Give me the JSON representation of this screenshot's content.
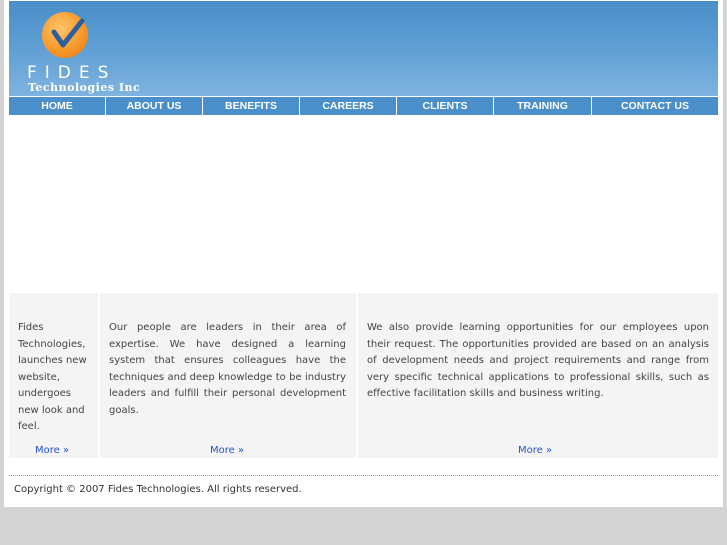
{
  "brand": {
    "name": "FIDES",
    "subtitle": "Technologies Inc"
  },
  "nav": {
    "items": [
      "HOME",
      "ABOUT US",
      "BENEFITS",
      "CAREERS",
      "CLIENTS",
      "TRAINING",
      "CONTACT US"
    ]
  },
  "columns": [
    {
      "text": "Fides Technologies, launches new website, undergoes new look and feel.",
      "more": "More »"
    },
    {
      "text": "Our people are leaders in their area of expertise. We have designed a learning system that ensures colleagues have the techniques and deep knowledge to be industry leaders and fulfill their personal development goals.",
      "more": "More »"
    },
    {
      "text": "We also provide learning opportunities for our employees upon their request. The opportunities provided are based on an analysis of development needs and project requirements and range from very specific technical applications to professional skills, such as effective facilitation skills and business writing.",
      "more": "More »"
    }
  ],
  "footer": {
    "copyright": "Copyright © 2007 Fides Technologies. All rights reserved."
  },
  "colors": {
    "header": "#5c9dd3",
    "nav": "#4a8fca",
    "logo": "#f7992b",
    "link": "#2255cc"
  }
}
